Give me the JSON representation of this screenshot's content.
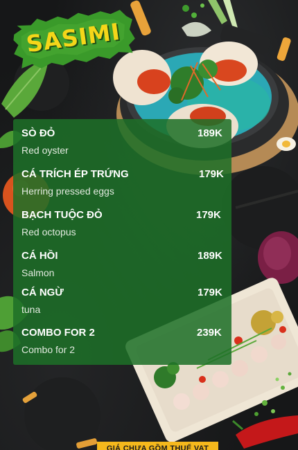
{
  "header": {
    "title": "SASIMI"
  },
  "menu": {
    "items": [
      {
        "name": "SÒ ĐỎ",
        "price": "189K",
        "subtitle": "Red oyster"
      },
      {
        "name": "CÁ TRÍCH ÉP TRỨNG",
        "price": "179K",
        "subtitle": "Herring pressed eggs"
      },
      {
        "name": "BẠCH TUỘC ĐỎ",
        "price": "179K",
        "subtitle": "Red octopus"
      },
      {
        "name": "CÁ HỒI",
        "price": "189K",
        "subtitle": "Salmon"
      },
      {
        "name": "CÁ NGỪ",
        "price": "179K",
        "subtitle": "tuna"
      },
      {
        "name": "COMBO FOR 2",
        "price": "239K",
        "subtitle": "Combo for 2"
      }
    ]
  },
  "footer": {
    "tax_note": "GIÁ CHƯA GỒM THUẾ VAT"
  },
  "colors": {
    "panel_green": "#1d7028",
    "title_yellow": "#f5d619",
    "badge_green": "#3a9a2a",
    "strip_yellow": "#f5b81c"
  },
  "icons": {
    "background": "sashimi-dish-photo"
  }
}
